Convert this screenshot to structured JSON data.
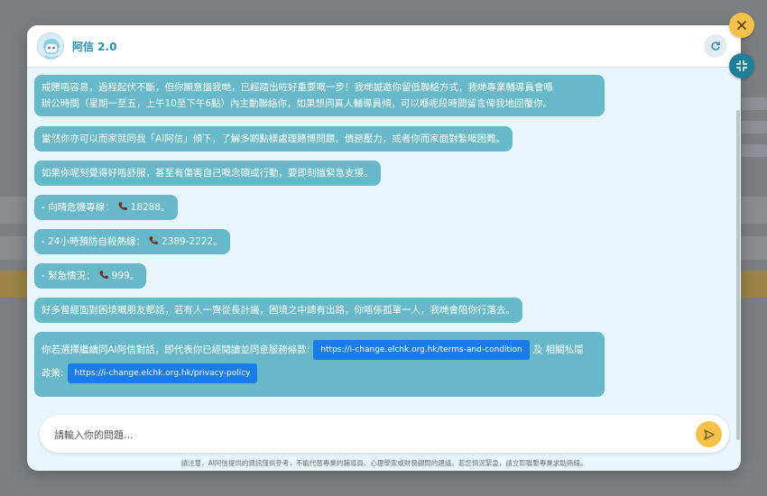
{
  "header": {
    "title": "阿信 2.0",
    "avatar_icon": "robot-avatar-icon",
    "refresh_icon": "refresh-icon"
  },
  "messages": [
    {
      "text_1": "戒賭唔容易，過程起伏不斷，但你願意搵我哋，已經踏出咗好重要嘅一步！我哋誠邀你留低聯絡方式，我哋專業輔導員會喺",
      "text_2": "辦公時間（星期一至五，上午10至下午6點）內主動聯絡你，如果想同真人輔導員傾，可以喺呢段時間留言俾我地回覆你。"
    },
    {
      "text": "當然你亦可以而家就同我「AI阿信」傾下，了解多啲點樣處理賭博問題、債務壓力，或者你而家面對緊嘅困難。"
    },
    {
      "text": "如果你呢刻覺得好唔舒服，甚至有傷害自己嘅念頭或行動，要即刻搵緊急支援。"
    },
    {
      "prefix": "- 向晴危機專線：",
      "number": "18288",
      "suffix": "。"
    },
    {
      "prefix": "- 24小時預防自殺熱線：",
      "number": "2389-2222",
      "suffix": "。"
    },
    {
      "prefix": "- 緊急情況：",
      "number": "999",
      "suffix": "。"
    },
    {
      "text": "好多曾經面對困境嘅朋友都話，若有人一齊從長計議，困境之中總有出路，你唔係孤單一人，我哋會陪你行落去。"
    },
    {
      "text_a": "你若選擇繼續同AI阿信對話，即代表你已經閱讀並同意服務條款:",
      "link_terms": "https://i-change.elchk.org.hk/terms-and-condition",
      "text_b": "及 相關私隱",
      "text_c": "政策:",
      "link_privacy": "https://i-change.elchk.org.hk/privacy-policy"
    }
  ],
  "input": {
    "placeholder": "請輸入你的問題..."
  },
  "disclaimer": "請注意，AI阿信提供的資訊僅供參考，不能代替專業的輔導員、心理學家或財務顧問的建議。若您情況緊急，請立即聯繫專業求助熱線。",
  "colors": {
    "bubble": "#67b9c9",
    "accent_yellow": "#f6c14b",
    "link_blue": "#1a7bea",
    "teal_button": "#1e7f96"
  }
}
